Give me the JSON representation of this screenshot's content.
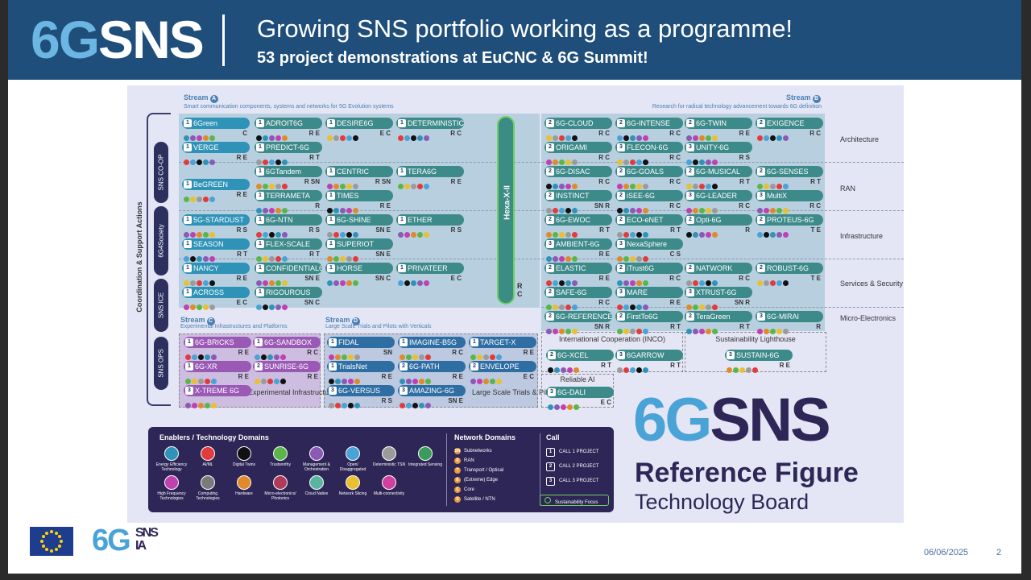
{
  "header": {
    "logo_6g": "6G",
    "logo_sns": "SNS",
    "title": "Growing SNS portfolio working as a programme!",
    "subtitle": "53 project demonstrations at EuCNC & 6G Summit!"
  },
  "streams": {
    "a_label": "Stream",
    "a_letter": "A",
    "a_desc": "Smart communication components, systems and networks for 5G Evolution systems",
    "b_label": "Stream",
    "b_letter": "B",
    "b_desc": "Research for radical technology advancement towards 6G definition",
    "c_label": "Stream",
    "c_letter": "C",
    "c_desc": "Experimental Infrastructures and Platforms",
    "d_label": "Stream",
    "d_letter": "D",
    "d_desc": "Large Scale Trials and Pilots with Verticals"
  },
  "coordination": "Coordination & Support Actions",
  "side_pills": [
    "SNS CO-OP",
    "6G4Society",
    "SNS ICE",
    "SNS OPS"
  ],
  "hexa": "Hexa-X-II",
  "rows": [
    "Architecture",
    "RAN",
    "Infrastructure",
    "Services & Security",
    "Micro-Electronics"
  ],
  "groups": {
    "inco": "International Cooperation (INCO)",
    "lighthouse": "Sustainability Lighthouse",
    "reliable_ai": "Reliable AI",
    "exp_infra": "Experimental Infrastructures",
    "large_trials": "Large Scale Trials & Pilots"
  },
  "projects": [
    {
      "name": "6Green",
      "call": "1",
      "nd": "C",
      "color": "#2f93b8"
    },
    {
      "name": "VERGE",
      "call": "1",
      "nd": "R E",
      "color": "#2f93b8"
    },
    {
      "name": "BeGREEN",
      "call": "1",
      "nd": "R E",
      "color": "#2f93b8"
    },
    {
      "name": "5G-STARDUST",
      "call": "1",
      "nd": "R S",
      "color": "#2f93b8"
    },
    {
      "name": "SEASON",
      "call": "1",
      "nd": "R T",
      "color": "#2f93b8"
    },
    {
      "name": "NANCY",
      "call": "1",
      "nd": "R E",
      "color": "#2f93b8"
    },
    {
      "name": "ACROSS",
      "call": "1",
      "nd": "E C",
      "color": "#2f93b8"
    },
    {
      "name": "ADROIT6G",
      "call": "1",
      "nd": "R E",
      "color": "#3d8a8a"
    },
    {
      "name": "PREDICT-6G",
      "call": "1",
      "nd": "R T",
      "color": "#3d8a8a"
    },
    {
      "name": "6GTandem",
      "call": "1",
      "nd": "R SN",
      "color": "#3d8a8a"
    },
    {
      "name": "TERRAMETA",
      "call": "1",
      "nd": "R",
      "color": "#3d8a8a"
    },
    {
      "name": "6G-NTN",
      "call": "1",
      "nd": "R S",
      "color": "#3d8a8a"
    },
    {
      "name": "FLEX-SCALE",
      "call": "1",
      "nd": "R T",
      "color": "#3d8a8a"
    },
    {
      "name": "CONFIDENTIAL6G",
      "call": "1",
      "nd": "SN E",
      "color": "#3d8a8a"
    },
    {
      "name": "RIGOUROUS",
      "call": "1",
      "nd": "SN C",
      "color": "#3d8a8a"
    },
    {
      "name": "DESIRE6G",
      "call": "1",
      "nd": "E C",
      "color": "#3d8a8a"
    },
    {
      "name": "CENTRIC",
      "call": "1",
      "nd": "R SN",
      "color": "#3d8a8a"
    },
    {
      "name": "TIMES",
      "call": "1",
      "nd": "R E",
      "color": "#3d8a8a"
    },
    {
      "name": "6G-SHINE",
      "call": "1",
      "nd": "SN E",
      "color": "#3d8a8a"
    },
    {
      "name": "SUPERIOT",
      "call": "1",
      "nd": "SN E",
      "color": "#3d8a8a"
    },
    {
      "name": "HORSE",
      "call": "1",
      "nd": "SN C",
      "color": "#3d8a8a"
    },
    {
      "name": "DETERMINISTIC6G",
      "call": "1",
      "nd": "R C",
      "color": "#3d8a8a"
    },
    {
      "name": "TERA6G",
      "call": "1",
      "nd": "R E",
      "color": "#3d8a8a"
    },
    {
      "name": "ETHER",
      "call": "1",
      "nd": "R S",
      "color": "#3d8a8a"
    },
    {
      "name": "PRIVATEER",
      "call": "1",
      "nd": "E C",
      "color": "#3d8a8a"
    },
    {
      "name": "6G-CLOUD",
      "call": "2",
      "nd": "R C",
      "color": "#3d8a8a"
    },
    {
      "name": "ORIGAMI",
      "call": "2",
      "nd": "R C",
      "color": "#3d8a8a"
    },
    {
      "name": "6G-DISAC",
      "call": "2",
      "nd": "R C",
      "color": "#3d8a8a"
    },
    {
      "name": "INSTINCT",
      "call": "2",
      "nd": "SN R",
      "color": "#3d8a8a"
    },
    {
      "name": "6G-EWOC",
      "call": "2",
      "nd": "R T",
      "color": "#3d8a8a"
    },
    {
      "name": "AMBIENT-6G",
      "call": "3",
      "nd": "R E",
      "color": "#3d8a8a"
    },
    {
      "name": "ELASTIC",
      "call": "2",
      "nd": "R E",
      "color": "#3d8a8a"
    },
    {
      "name": "SAFE-6G",
      "call": "2",
      "nd": "R C",
      "color": "#3d8a8a"
    },
    {
      "name": "6G-REFERENCE",
      "call": "2",
      "nd": "SN R",
      "color": "#3d8a8a"
    },
    {
      "name": "6G-INTENSE",
      "call": "2",
      "nd": "R C",
      "color": "#3d8a8a"
    },
    {
      "name": "FLECON-6G",
      "call": "3",
      "nd": "R C",
      "color": "#3d8a8a"
    },
    {
      "name": "6G-GOALS",
      "call": "2",
      "nd": "R C",
      "color": "#3d8a8a"
    },
    {
      "name": "iSEE-6G",
      "call": "2",
      "nd": "R C",
      "color": "#3d8a8a"
    },
    {
      "name": "ECO-eNET",
      "call": "2",
      "nd": "R T",
      "color": "#3d8a8a"
    },
    {
      "name": "NexaSphere",
      "call": "3",
      "nd": "C S",
      "color": "#3d8a8a"
    },
    {
      "name": "iTrust6G",
      "call": "2",
      "nd": "R C",
      "color": "#3d8a8a"
    },
    {
      "name": "MARE",
      "call": "3",
      "nd": "R E",
      "color": "#3d8a8a"
    },
    {
      "name": "FirstTo6G",
      "call": "2",
      "nd": "R T",
      "color": "#3d8a8a"
    },
    {
      "name": "6G-TWIN",
      "call": "2",
      "nd": "R E",
      "color": "#3d8a8a"
    },
    {
      "name": "UNITY-6G",
      "call": "3",
      "nd": "R S",
      "color": "#3d8a8a"
    },
    {
      "name": "6G-MUSICAL",
      "call": "2",
      "nd": "R T",
      "color": "#3d8a8a"
    },
    {
      "name": "6G-LEADER",
      "call": "3",
      "nd": "R C",
      "color": "#3d8a8a"
    },
    {
      "name": "Opti-6G",
      "call": "2",
      "nd": "R",
      "color": "#3d8a8a"
    },
    {
      "name": "NATWORK",
      "call": "2",
      "nd": "R C",
      "color": "#3d8a8a"
    },
    {
      "name": "XTRUST-6G",
      "call": "3",
      "nd": "SN R",
      "color": "#3d8a8a"
    },
    {
      "name": "TeraGreen",
      "call": "2",
      "nd": "R T",
      "color": "#3d8a8a"
    },
    {
      "name": "EXIGENCE",
      "call": "2",
      "nd": "R C",
      "color": "#3d8a8a"
    },
    {
      "name": "6G-SENSES",
      "call": "2",
      "nd": "R T",
      "color": "#3d8a8a"
    },
    {
      "name": "MultiX",
      "call": "3",
      "nd": "R C",
      "color": "#3d8a8a"
    },
    {
      "name": "PROTEUS-6G",
      "call": "2",
      "nd": "T E",
      "color": "#3d8a8a"
    },
    {
      "name": "ROBUST-6G",
      "call": "2",
      "nd": "T E",
      "color": "#3d8a8a"
    },
    {
      "name": "6G-MIRAI",
      "call": "3",
      "nd": "R",
      "color": "#3d8a8a"
    },
    {
      "name": "6G-XCEL",
      "call": "2",
      "nd": "R T",
      "color": "#3d8a8a"
    },
    {
      "name": "6GARROW",
      "call": "3",
      "nd": "R T",
      "color": "#3d8a8a"
    },
    {
      "name": "SUSTAIN-6G",
      "call": "3",
      "nd": "R E",
      "color": "#3d8a8a"
    },
    {
      "name": "6G-DALI",
      "call": "3",
      "nd": "E C",
      "color": "#3d8a8a"
    },
    {
      "name": "6G-BRICKS",
      "call": "1",
      "nd": "R E",
      "color": "#9b59b6"
    },
    {
      "name": "6G-XR",
      "call": "1",
      "nd": "R E",
      "color": "#9b59b6"
    },
    {
      "name": "X-TREME 6G",
      "call": "3",
      "nd": "",
      "color": "#9b59b6"
    },
    {
      "name": "6G-SANDBOX",
      "call": "1",
      "nd": "R C",
      "color": "#9b59b6"
    },
    {
      "name": "SUNRISE-6G",
      "call": "2",
      "nd": "R E",
      "color": "#9b59b6"
    },
    {
      "name": "FIDAL",
      "call": "1",
      "nd": "SN",
      "color": "#2f6ea3"
    },
    {
      "name": "TrialsNet",
      "call": "1",
      "nd": "R E",
      "color": "#2f6ea3"
    },
    {
      "name": "6G-VERSUS",
      "call": "3",
      "nd": "R S",
      "color": "#2f6ea3"
    },
    {
      "name": "IMAGINE-B5G",
      "call": "1",
      "nd": "R C",
      "color": "#2f6ea3"
    },
    {
      "name": "6G-PATH",
      "call": "2",
      "nd": "R E",
      "color": "#2f6ea3"
    },
    {
      "name": "AMAZING-6G",
      "call": "3",
      "nd": "SN E",
      "color": "#2f6ea3"
    },
    {
      "name": "TARGET-X",
      "call": "1",
      "nd": "R E",
      "color": "#2f6ea3"
    },
    {
      "name": "ENVELOPE",
      "call": "2",
      "nd": "E C",
      "color": "#2f6ea3"
    }
  ],
  "legend": {
    "enablers_title": "Enablers / Technology Domains",
    "enablers": [
      {
        "label": "Energy Efficiency Technology",
        "color": "#2f93b8"
      },
      {
        "label": "AI/ML",
        "color": "#e23b3b"
      },
      {
        "label": "Digital Twins",
        "color": "#111111"
      },
      {
        "label": "Trustworthy",
        "color": "#5ab54a"
      },
      {
        "label": "Management & Orchestration",
        "color": "#8a5ab5"
      },
      {
        "label": "Open/ Disaggregated",
        "color": "#4aa3d6"
      },
      {
        "label": "Deterministic TSN",
        "color": "#9b9b9b"
      },
      {
        "label": "Integrated Sensing",
        "color": "#3a9b5a"
      },
      {
        "label": "High Frequency Technologies",
        "color": "#c040b0"
      },
      {
        "label": "Computing Technologies",
        "color": "#7a7a7a"
      },
      {
        "label": "Hardware",
        "color": "#e08a2a"
      },
      {
        "label": "Micro-electronics/ Photonics",
        "color": "#b03a5a"
      },
      {
        "label": "Cloud Native",
        "color": "#5ab5a0"
      },
      {
        "label": "Network Slicing",
        "color": "#e8c030"
      },
      {
        "label": "Multi-connectivity",
        "color": "#d040a0"
      }
    ],
    "network_title": "Network Domains",
    "network": [
      {
        "code": "SN",
        "label": "Subnetworks"
      },
      {
        "code": "R",
        "label": "RAN"
      },
      {
        "code": "T",
        "label": "Transport / Optical"
      },
      {
        "code": "E",
        "label": "(Extreme) Edge"
      },
      {
        "code": "C",
        "label": "Core"
      },
      {
        "code": "S",
        "label": "Satellite / NTN"
      }
    ],
    "call_title": "Call",
    "calls": [
      {
        "code": "1",
        "label": "CALL 1 PROJECT"
      },
      {
        "code": "2",
        "label": "CALL 2 PROJECT"
      },
      {
        "code": "3",
        "label": "CALL 3 PROJECT"
      }
    ],
    "sustain": "Sustainability Focus"
  },
  "ref": {
    "logo_6g": "6G",
    "logo_sns": "SNS",
    "title": "Reference Figure",
    "subtitle": "Technology Board"
  },
  "footer": {
    "logo_6g": "6G",
    "logo_sns": "SNS",
    "logo_ia": "IA",
    "date": "06/06/2025",
    "page": "2"
  }
}
